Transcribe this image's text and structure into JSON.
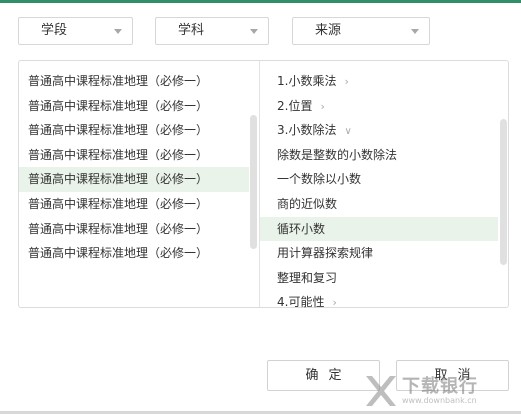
{
  "filters": [
    {
      "label": "学段"
    },
    {
      "label": "学科"
    },
    {
      "label": "来源"
    }
  ],
  "left_list": [
    {
      "label": "普通高中课程标准地理（必修一）",
      "selected": false
    },
    {
      "label": "普通高中课程标准地理（必修一）",
      "selected": false
    },
    {
      "label": "普通高中课程标准地理（必修一）",
      "selected": false
    },
    {
      "label": "普通高中课程标准地理（必修一）",
      "selected": false
    },
    {
      "label": "普通高中课程标准地理（必修一）",
      "selected": true
    },
    {
      "label": "普通高中课程标准地理（必修一）",
      "selected": false
    },
    {
      "label": "普通高中课程标准地理（必修一）",
      "selected": false
    },
    {
      "label": "普通高中课程标准地理（必修一）",
      "selected": false
    }
  ],
  "right_list": [
    {
      "label": "1.小数乘法",
      "icon": "chevron-right-icon",
      "selected": false
    },
    {
      "label": "2.位置",
      "icon": "chevron-right-icon",
      "selected": false
    },
    {
      "label": "3.小数除法",
      "icon": "chevron-down-icon",
      "selected": false
    },
    {
      "label": "除数是整数的小数除法",
      "icon": "",
      "selected": false
    },
    {
      "label": "一个数除以小数",
      "icon": "",
      "selected": false
    },
    {
      "label": "商的近似数",
      "icon": "",
      "selected": false
    },
    {
      "label": "循环小数",
      "icon": "",
      "selected": true
    },
    {
      "label": "用计算器探索规律",
      "icon": "",
      "selected": false
    },
    {
      "label": "整理和复习",
      "icon": "",
      "selected": false
    },
    {
      "label": "4.可能性",
      "icon": "chevron-right-icon",
      "selected": false
    }
  ],
  "buttons": {
    "ok_label": "确定",
    "cancel_label": "取消"
  },
  "watermark": {
    "text": "下载银行",
    "subtext": "www.downbank.cn"
  },
  "colors": {
    "accent": "#2f8f68",
    "selected_row": "#eaf3ea",
    "border": "#dcdcdc"
  }
}
